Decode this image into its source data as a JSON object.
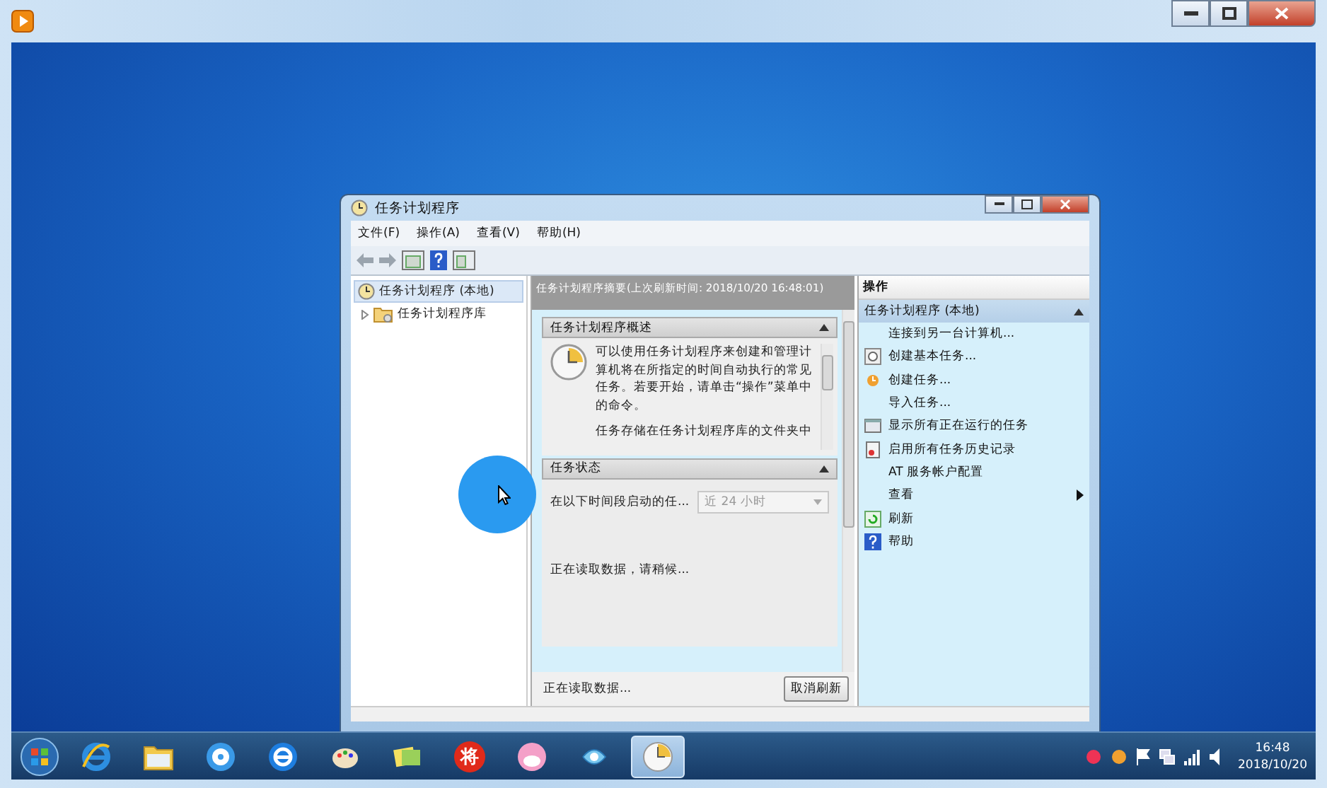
{
  "window": {
    "title": "任务计划程序"
  },
  "menu": [
    "文件(F)",
    "操作(A)",
    "查看(V)",
    "帮助(H)"
  ],
  "tree": [
    {
      "label": "任务计划程序 (本地)",
      "selected": true,
      "children": [
        {
          "label": "任务计划程序库",
          "selected": false,
          "expanded": false
        }
      ]
    }
  ],
  "summary": {
    "header": "任务计划程序摘要(上次刷新时间: 2018/10/20 16:48:01)",
    "sections": [
      {
        "kind": "overview",
        "title": "任务计划程序概述",
        "expanded": true,
        "paragraphs": [
          "可以使用任务计划程序来创建和管理计算机将在所指定的时间自动执行的常见任务。若要开始，请单击“操作”菜单中的命令。",
          "任务存储在任务计划程序库的文件夹中"
        ]
      },
      {
        "kind": "status",
        "title": "任务状态",
        "expanded": true,
        "filter_label": "在以下时间段启动的任...",
        "filter_value": "近 24 小时",
        "message": "正在读取数据，请稍候..."
      }
    ],
    "status": "正在读取数据...",
    "button": "取消刷新"
  },
  "actions": {
    "title": "操作",
    "group": "任务计划程序 (本地)",
    "expanded": true,
    "items": [
      {
        "label": "连接到另一台计算机...",
        "kind": "command"
      },
      {
        "label": "创建基本任务...",
        "kind": "command"
      },
      {
        "label": "创建任务...",
        "kind": "command"
      },
      {
        "label": "导入任务...",
        "kind": "command"
      },
      {
        "label": "显示所有正在运行的任务",
        "kind": "command"
      },
      {
        "label": "启用所有任务历史记录",
        "kind": "command"
      },
      {
        "label": "AT 服务帐户配置",
        "kind": "command"
      },
      {
        "label": "查看",
        "kind": "submenu"
      },
      {
        "label": "刷新",
        "kind": "command"
      },
      {
        "label": "帮助",
        "kind": "command"
      }
    ]
  },
  "taskbar": {
    "badge_text": "将",
    "time": "16:48",
    "date": "2018/10/20"
  }
}
